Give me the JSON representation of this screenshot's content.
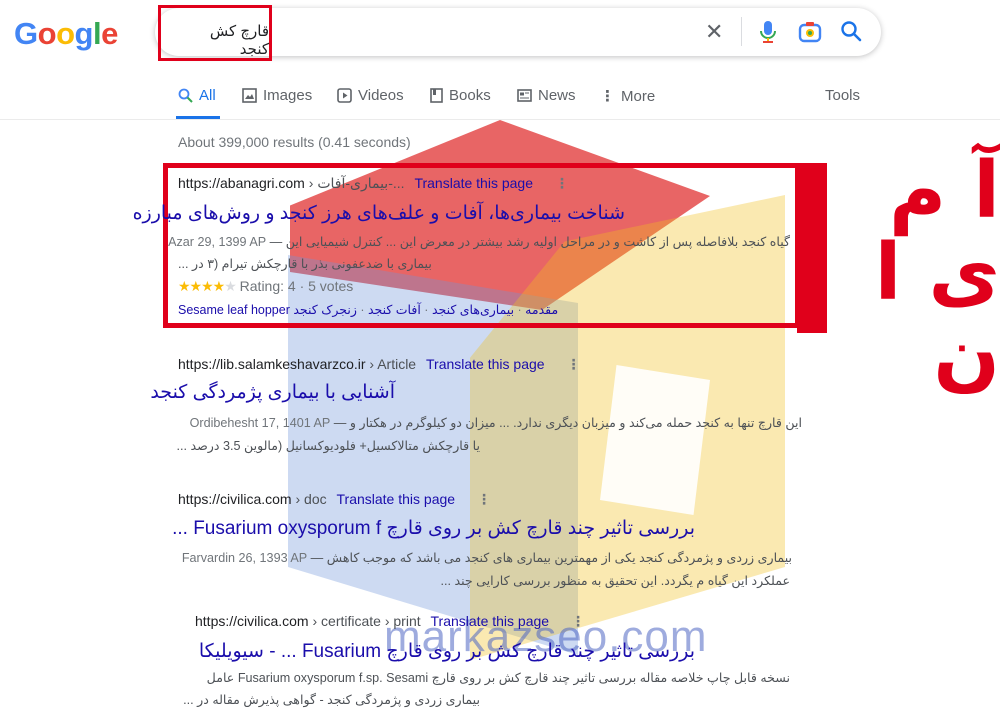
{
  "header": {
    "logo": [
      "G",
      "o",
      "o",
      "g",
      "l",
      "e"
    ],
    "query": "قارچ کش کنجد"
  },
  "tabs": [
    {
      "label": "All",
      "icon": "search-icon"
    },
    {
      "label": "Images",
      "icon": "image-icon"
    },
    {
      "label": "Videos",
      "icon": "video-icon"
    },
    {
      "label": "Books",
      "icon": "book-icon"
    },
    {
      "label": "News",
      "icon": "news-icon"
    },
    {
      "label": "More",
      "icon": "more-vert-icon"
    }
  ],
  "tools_label": "Tools",
  "stats": "About 399,000 results (0.41 seconds)",
  "results": [
    {
      "site": "https://abanagri.com",
      "crumb": " › بیماری-آفات-... ",
      "translate": "Translate this page",
      "title": "شناخت بیماری‌ها، آفات و علف‌های هرز کنجد و روش‌های مبارزه",
      "date": "Azar 29, 1399 AP",
      "snippet1": "گیاه کنجد بلافاصله پس از کاشت و در مراحل اولیه رشد بیشتر در معرض این ... کنترل شیمیایی این",
      "snippet2": "بیماری با ضدعفونی بذر با قارچکش تیرام (۳ در ...",
      "rating_text": "Rating: 4 · 5 votes",
      "sitelinks": [
        "مقدمه",
        "بیماری‌های کنجد",
        "آفات کنجد",
        "زنجرک کنجد Sesame leaf hopper"
      ]
    },
    {
      "site": "https://lib.salamkeshavarzco.ir",
      "crumb": " › Article ",
      "translate": "Translate this page",
      "title": "آشنایی با بیماری پژمردگی کنجد",
      "date": "Ordibehesht 17, 1401 AP",
      "snippet1": "این قارچ تنها به کنجد حمله می‌کند و میزبان دیگری ندارد. ... میزان دو کیلوگرم در هکتار و",
      "snippet2": "یا قارچکش متالاکسیل+ فلودیوکسانیل (مالوین 3.5 درصد ..."
    },
    {
      "site": "https://civilica.com",
      "crumb": " › doc ",
      "translate": "Translate this page",
      "title": "بررسی تاثیر چند قارچ کش بر روی قارچ Fusarium oxysporum f ...",
      "date": "Farvardin 26, 1393 AP",
      "snippet1": "بیماری زردی و پژمردگی کنجد یکی از مهمترین بیماری های کنجد می باشد که موجب کاهش",
      "snippet2": "عملکرد این گیاه م یگردد. این تحقیق به منظور بررسی کارایی چند ..."
    },
    {
      "site": "https://civilica.com",
      "crumb": " › certificate › print ",
      "translate": "Translate this page",
      "title": "بررسی تاثیر چند قارچ کش بر روی قارچ Fusarium ... - سیویلیکا",
      "snippet1": "نسخه قابل چاپ خلاصه مقاله بررسی تاثیر چند قارچ کش بر روی قارچ Fusarium oxysporum f.sp. Sesami عامل",
      "snippet2": "بیماری زردی و پژمردگی کنجد - گواهی پذیرش مقاله در ..."
    }
  ],
  "overlay": {
    "watermark": "markazseo.com",
    "side_text_1": "آ م",
    "side_text_2": "ی ا ن"
  },
  "colors": {
    "link": "#1a0dab",
    "accent": "#1a73e8",
    "highlight": "#e0001b",
    "star": "#fbbc05"
  }
}
